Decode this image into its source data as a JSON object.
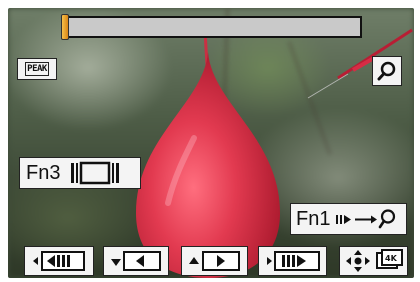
{
  "playback": {
    "progress_percent": 1
  },
  "buttons": {
    "peak_label": "PEAK",
    "fn3_label": "Fn3",
    "fn1_label": "Fn1"
  },
  "icons": {
    "peak": "peaking-icon",
    "zoom": "magnifier-icon",
    "fn3": "frame-view-icon",
    "fn1": "frame-to-zoom-icon",
    "b1": "previous-frame-skip-icon",
    "b2": "step-back-icon",
    "b3": "step-forward-icon",
    "b4": "next-frame-skip-icon",
    "b5": "move-crop-icon"
  },
  "colors": {
    "progress_fill": "#f2a53a",
    "balloon": "#e03a50",
    "panel": "#f4f4f4"
  }
}
